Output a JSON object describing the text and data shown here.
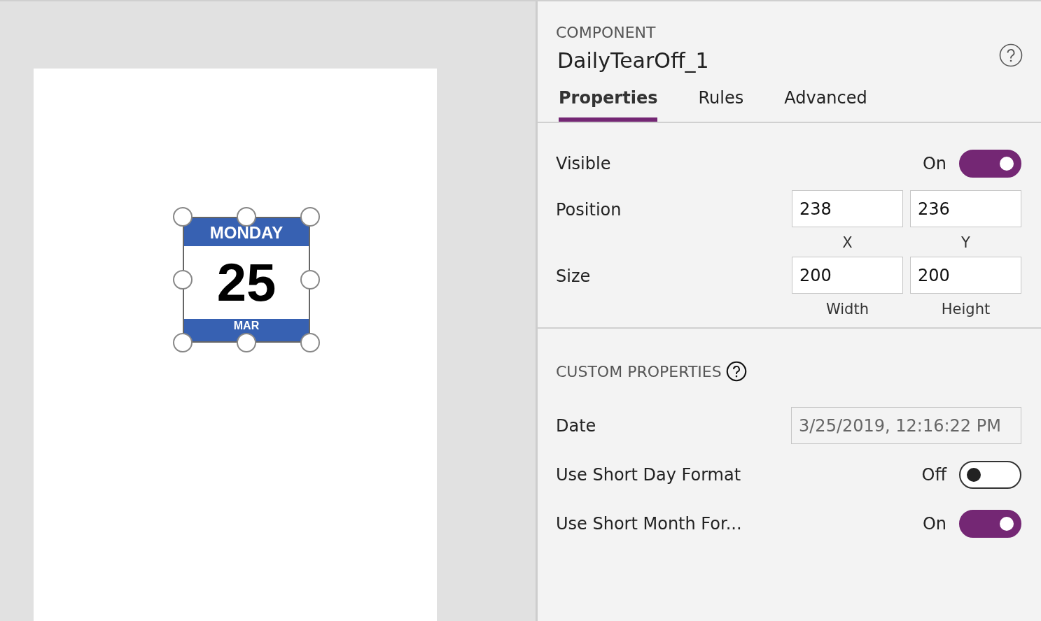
{
  "canvas": {
    "component": {
      "day": "MONDAY",
      "date": "25",
      "month": "MAR",
      "selected": true
    }
  },
  "panel": {
    "heading": "COMPONENT",
    "name": "DailyTearOff_1",
    "tabs": [
      {
        "label": "Properties",
        "selected": true
      },
      {
        "label": "Rules",
        "selected": false
      },
      {
        "label": "Advanced",
        "selected": false
      }
    ],
    "visible": {
      "label": "Visible",
      "state_label": "On",
      "on": true
    },
    "position": {
      "label": "Position",
      "fields": [
        {
          "value": "238",
          "caption": "X"
        },
        {
          "value": "236",
          "caption": "Y"
        }
      ]
    },
    "size": {
      "label": "Size",
      "fields": [
        {
          "value": "200",
          "caption": "Width"
        },
        {
          "value": "200",
          "caption": "Height"
        }
      ]
    },
    "custom_heading": "CUSTOM PROPERTIES",
    "custom": [
      {
        "kind": "text",
        "label": "Date",
        "value": "3/25/2019, 12:16:22 PM",
        "disabled": true
      },
      {
        "kind": "toggle",
        "label": "Use Short Day Format",
        "state_label": "Off",
        "on": false
      },
      {
        "kind": "toggle",
        "label": "Use Short Month For...",
        "state_label": "On",
        "on": true
      }
    ]
  }
}
